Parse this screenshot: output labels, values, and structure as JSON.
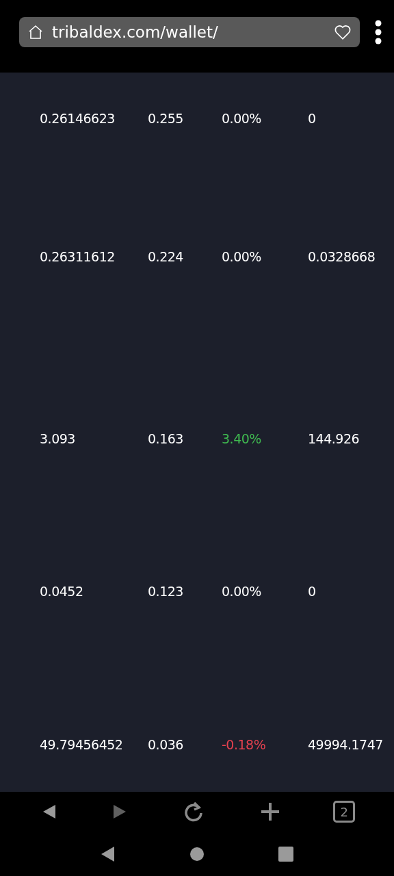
{
  "address_bar": {
    "url": "tribaldex.com/wallet/"
  },
  "rows": [
    {
      "balance": "0.26146623",
      "price": "0.255",
      "change": "0.00%",
      "color": "#ffffff",
      "value": "0"
    },
    {
      "balance": "0.26311612",
      "price": "0.224",
      "change": "0.00%",
      "color": "#ffffff",
      "value": "0.0328668"
    },
    {
      "balance": "3.093",
      "price": "0.163",
      "change": "3.40%",
      "color": "#3fb950",
      "value": "144.926"
    },
    {
      "balance": "0.0452",
      "price": "0.123",
      "change": "0.00%",
      "color": "#ffffff",
      "value": "0"
    },
    {
      "balance": "49.79456452",
      "price": "0.036",
      "change": "-0.18%",
      "color": "#e5414f",
      "value": "49994.1747"
    }
  ],
  "browser_toolbar": {
    "tab_count": "2"
  }
}
